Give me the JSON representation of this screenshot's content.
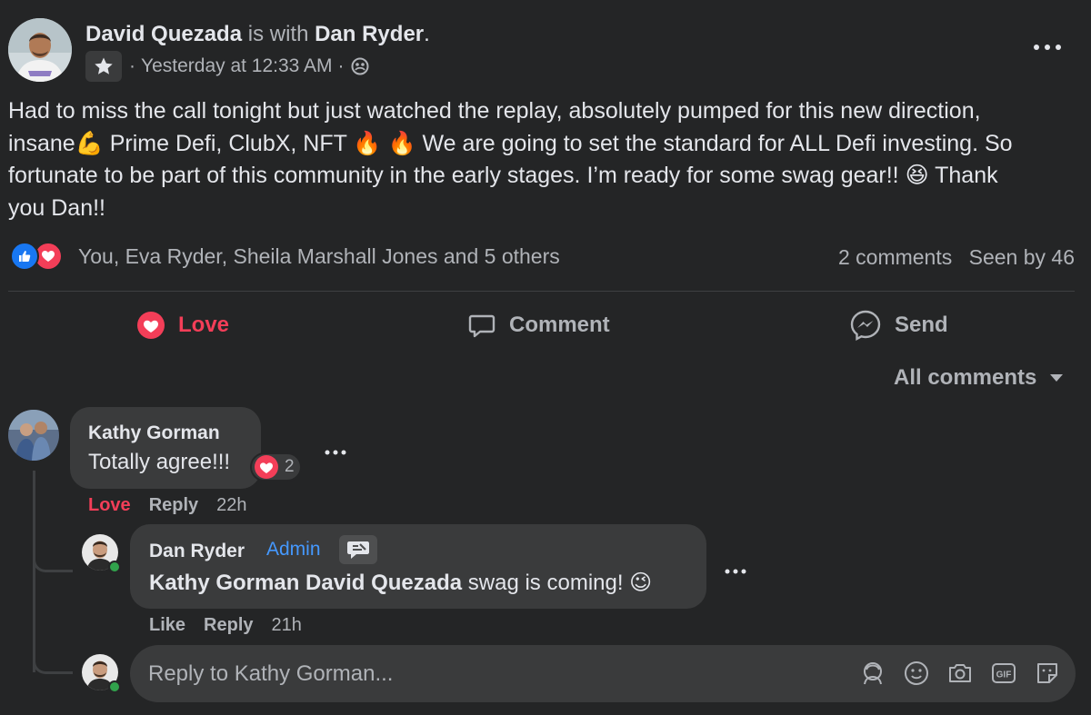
{
  "post": {
    "author": "David Quezada",
    "with_text": "is with",
    "tagged": "Dan Ryder",
    "period": ".",
    "timestamp": "Yesterday at 12:33 AM",
    "meta_sep": "·",
    "lines": [
      "Had to miss the call tonight but just watched the replay, absolutely pumped for this new direction,",
      "insane💪 Prime Defi, ClubX, NFT 🔥 🔥 We are going to set the standard for ALL Defi investing.  So",
      "fortunate to be part of this community in the early stages.  I’m ready for some swag gear!! 😆 Thank",
      "you Dan!!"
    ],
    "reactors": "You, Eva Ryder, Sheila Marshall Jones and 5 others",
    "comments_count": "2 comments",
    "seen_by": "Seen by 46"
  },
  "actions": {
    "love": "Love",
    "comment": "Comment",
    "send": "Send"
  },
  "filter": {
    "label": "All comments"
  },
  "comments": {
    "kathy": {
      "name": "Kathy Gorman",
      "text": "Totally agree!!!",
      "reaction_count": "2",
      "love": "Love",
      "reply": "Reply",
      "time": "22h"
    },
    "dan": {
      "name": "Dan Ryder",
      "badge": "Admin",
      "mention1": "Kathy Gorman",
      "mention2": "David Quezada",
      "text": " swag is coming! 😉",
      "like": "Like",
      "reply": "Reply",
      "time": "21h"
    }
  },
  "composer": {
    "placeholder": "Reply to Kathy Gorman..."
  },
  "colors": {
    "background": "#242526",
    "bubble": "#3a3b3c",
    "love": "#f33e58",
    "like": "#1877f2",
    "admin": "#4599ff"
  }
}
